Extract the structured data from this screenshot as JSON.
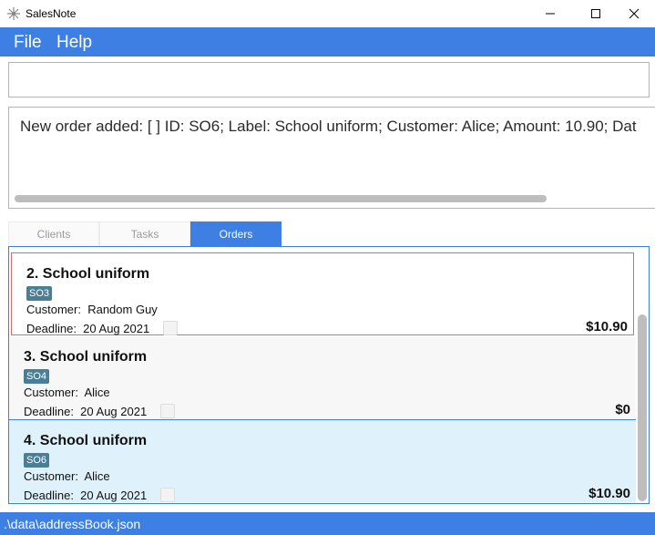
{
  "window": {
    "title": "SalesNote",
    "minimize_icon": "minimize-icon",
    "maximize_icon": "maximize-icon",
    "close_icon": "close-icon"
  },
  "menu": {
    "items": [
      "File",
      "Help"
    ]
  },
  "command": {
    "value": "",
    "placeholder": ""
  },
  "result": {
    "text": "New order added: [ ] ID: SO6; Label: School uniform; Customer: Alice; Amount: 10.90; Dat"
  },
  "tabs": [
    {
      "label": "Clients",
      "active": false
    },
    {
      "label": "Tasks",
      "active": false
    },
    {
      "label": "Orders",
      "active": true
    }
  ],
  "orders": [
    {
      "title": "2. School uniform",
      "tag": "SO3",
      "customer_label": "Customer:",
      "customer": "Random Guy",
      "deadline_label": "Deadline:",
      "deadline": "20 Aug 2021",
      "amount": "$10.90",
      "background": "#ffffff",
      "highlighted": true
    },
    {
      "title": "3. School uniform",
      "tag": "SO4",
      "customer_label": "Customer:",
      "customer": "Alice",
      "deadline_label": "Deadline:",
      "deadline": "20 Aug 2021",
      "amount": "$0",
      "background": "#f7f7f7",
      "highlighted": false
    },
    {
      "title": "4. School uniform",
      "tag": "SO6",
      "customer_label": "Customer:",
      "customer": "Alice",
      "deadline_label": "Deadline:",
      "deadline": "20 Aug 2021",
      "amount": "$10.90",
      "background": "#dff1fa",
      "highlighted": false
    }
  ],
  "status": {
    "path": ".\\data\\addressBook.json"
  },
  "colors": {
    "accent": "#3d7fe3",
    "tag": "#4a7d96",
    "selected_border": "#d66b6b",
    "selected_row": "#dff1fa"
  }
}
